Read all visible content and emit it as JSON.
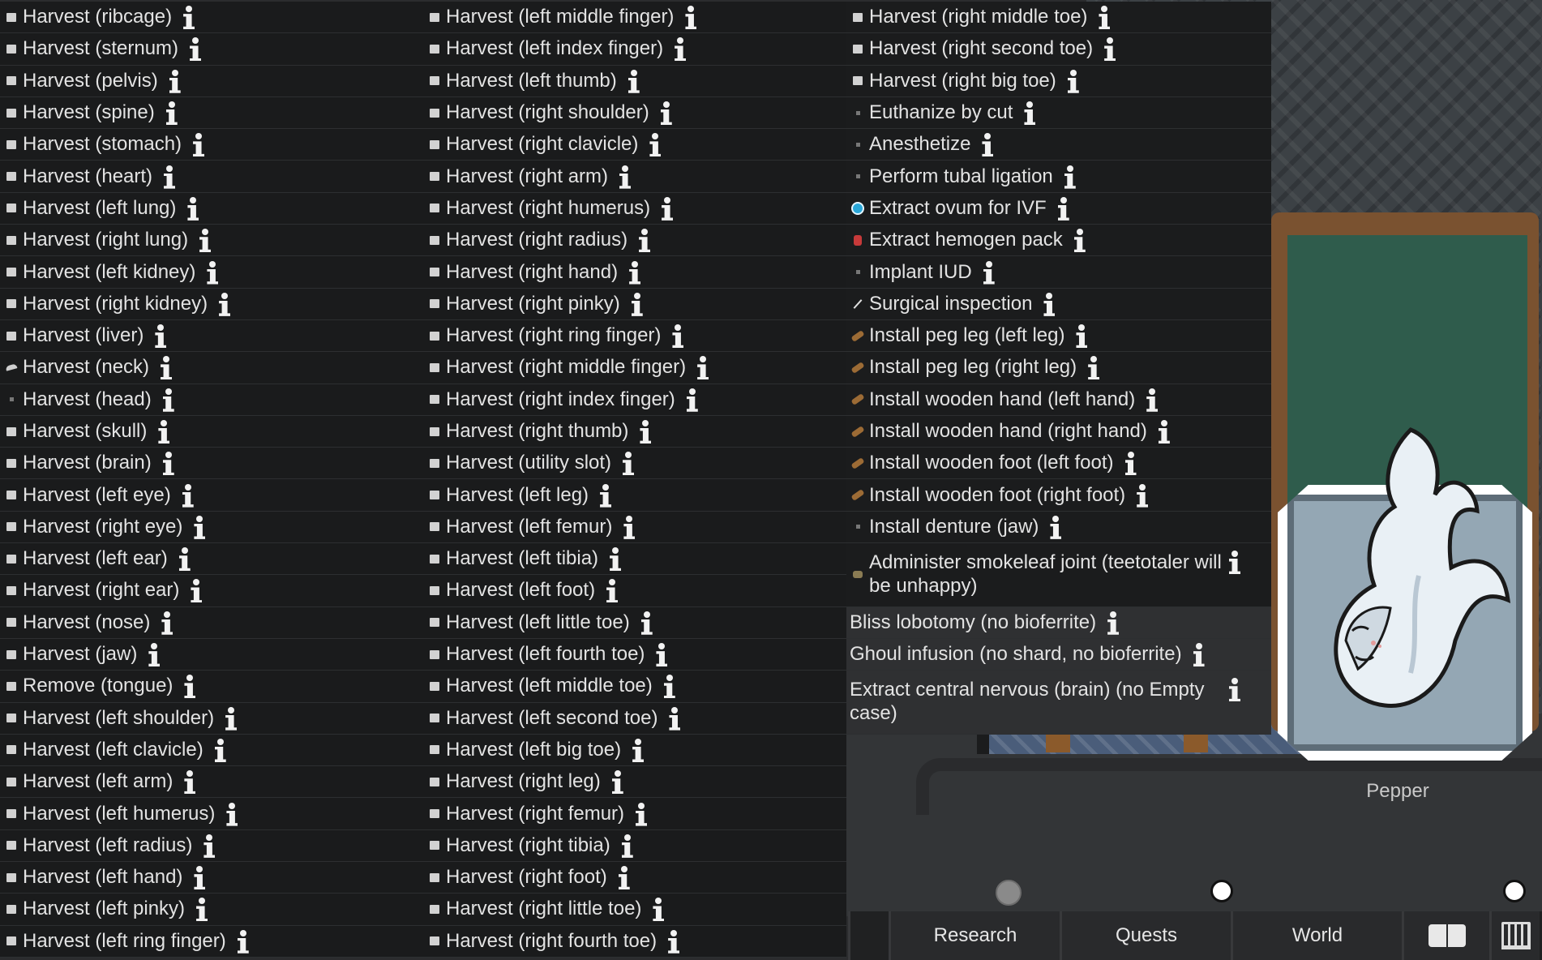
{
  "menu": {
    "col_a": [
      {
        "label": "Harvest (ribcage)",
        "icon": "square-icon"
      },
      {
        "label": "Harvest (sternum)",
        "icon": "square-icon"
      },
      {
        "label": "Harvest (pelvis)",
        "icon": "square-icon"
      },
      {
        "label": "Harvest (spine)",
        "icon": "square-icon"
      },
      {
        "label": "Harvest (stomach)",
        "icon": "square-icon"
      },
      {
        "label": "Harvest (heart)",
        "icon": "square-icon"
      },
      {
        "label": "Harvest (left lung)",
        "icon": "square-icon"
      },
      {
        "label": "Harvest (right lung)",
        "icon": "square-icon"
      },
      {
        "label": "Harvest (left kidney)",
        "icon": "square-icon"
      },
      {
        "label": "Harvest (right kidney)",
        "icon": "square-icon"
      },
      {
        "label": "Harvest (liver)",
        "icon": "square-icon"
      },
      {
        "label": "Harvest (neck)",
        "icon": "knife-icon"
      },
      {
        "label": "Harvest (head)",
        "icon": "dot-icon"
      },
      {
        "label": "Harvest (skull)",
        "icon": "square-icon"
      },
      {
        "label": "Harvest (brain)",
        "icon": "square-icon"
      },
      {
        "label": "Harvest (left eye)",
        "icon": "square-icon"
      },
      {
        "label": "Harvest (right eye)",
        "icon": "square-icon"
      },
      {
        "label": "Harvest (left ear)",
        "icon": "square-icon"
      },
      {
        "label": "Harvest (right ear)",
        "icon": "square-icon"
      },
      {
        "label": "Harvest (nose)",
        "icon": "square-icon"
      },
      {
        "label": "Harvest (jaw)",
        "icon": "square-icon"
      },
      {
        "label": "Remove (tongue)",
        "icon": "square-icon"
      },
      {
        "label": "Harvest (left shoulder)",
        "icon": "square-icon"
      },
      {
        "label": "Harvest (left clavicle)",
        "icon": "square-icon"
      },
      {
        "label": "Harvest (left arm)",
        "icon": "square-icon"
      },
      {
        "label": "Harvest (left humerus)",
        "icon": "square-icon"
      },
      {
        "label": "Harvest (left radius)",
        "icon": "square-icon"
      },
      {
        "label": "Harvest (left hand)",
        "icon": "square-icon"
      },
      {
        "label": "Harvest (left pinky)",
        "icon": "square-icon"
      },
      {
        "label": "Harvest (left ring finger)",
        "icon": "square-icon"
      }
    ],
    "col_b": [
      {
        "label": "Harvest (left middle finger)",
        "icon": "square-icon"
      },
      {
        "label": "Harvest (left index finger)",
        "icon": "square-icon"
      },
      {
        "label": "Harvest (left thumb)",
        "icon": "square-icon"
      },
      {
        "label": "Harvest (right shoulder)",
        "icon": "square-icon"
      },
      {
        "label": "Harvest (right clavicle)",
        "icon": "square-icon"
      },
      {
        "label": "Harvest (right arm)",
        "icon": "square-icon"
      },
      {
        "label": "Harvest (right humerus)",
        "icon": "square-icon"
      },
      {
        "label": "Harvest (right radius)",
        "icon": "square-icon"
      },
      {
        "label": "Harvest (right hand)",
        "icon": "square-icon"
      },
      {
        "label": "Harvest (right pinky)",
        "icon": "square-icon"
      },
      {
        "label": "Harvest (right ring finger)",
        "icon": "square-icon"
      },
      {
        "label": "Harvest (right middle finger)",
        "icon": "square-icon"
      },
      {
        "label": "Harvest (right index finger)",
        "icon": "square-icon"
      },
      {
        "label": "Harvest (right thumb)",
        "icon": "square-icon"
      },
      {
        "label": "Harvest (utility slot)",
        "icon": "square-icon"
      },
      {
        "label": "Harvest (left leg)",
        "icon": "square-icon"
      },
      {
        "label": "Harvest (left femur)",
        "icon": "square-icon"
      },
      {
        "label": "Harvest (left tibia)",
        "icon": "square-icon"
      },
      {
        "label": "Harvest (left foot)",
        "icon": "square-icon"
      },
      {
        "label": "Harvest (left little toe)",
        "icon": "square-icon"
      },
      {
        "label": "Harvest (left fourth toe)",
        "icon": "square-icon"
      },
      {
        "label": "Harvest (left middle toe)",
        "icon": "square-icon"
      },
      {
        "label": "Harvest (left second toe)",
        "icon": "square-icon"
      },
      {
        "label": "Harvest (left big toe)",
        "icon": "square-icon"
      },
      {
        "label": "Harvest (right leg)",
        "icon": "square-icon"
      },
      {
        "label": "Harvest (right femur)",
        "icon": "square-icon"
      },
      {
        "label": "Harvest (right tibia)",
        "icon": "square-icon"
      },
      {
        "label": "Harvest (right foot)",
        "icon": "square-icon"
      },
      {
        "label": "Harvest (right little toe)",
        "icon": "square-icon"
      },
      {
        "label": "Harvest (right fourth toe)",
        "icon": "square-icon"
      }
    ],
    "col_c": [
      {
        "label": "Harvest (right middle toe)",
        "icon": "square-icon"
      },
      {
        "label": "Harvest (right second toe)",
        "icon": "square-icon"
      },
      {
        "label": "Harvest (right big toe)",
        "icon": "square-icon"
      },
      {
        "label": "Euthanize by cut",
        "icon": "dot-icon"
      },
      {
        "label": "Anesthetize",
        "icon": "dot-icon"
      },
      {
        "label": "Perform tubal ligation",
        "icon": "dot-icon"
      },
      {
        "label": "Extract ovum for IVF",
        "icon": "ovum-icon"
      },
      {
        "label": "Extract hemogen pack",
        "icon": "hemogen-pack-icon"
      },
      {
        "label": "Implant IUD",
        "icon": "dot-icon"
      },
      {
        "label": "Surgical inspection",
        "icon": "scalpel-line-icon"
      },
      {
        "label": "Install peg leg (left leg)",
        "icon": "peg-leg-icon"
      },
      {
        "label": "Install peg leg (right leg)",
        "icon": "peg-leg-icon"
      },
      {
        "label": "Install wooden hand (left hand)",
        "icon": "wooden-hand-icon"
      },
      {
        "label": "Install wooden hand (right hand)",
        "icon": "wooden-hand-icon"
      },
      {
        "label": "Install wooden foot (left foot)",
        "icon": "wooden-foot-icon"
      },
      {
        "label": "Install wooden foot (right foot)",
        "icon": "wooden-foot-icon"
      },
      {
        "label": "Install denture (jaw)",
        "icon": "dot-icon"
      },
      {
        "label": "Administer smokeleaf joint (teetotaler will be unhappy)",
        "icon": "smokeleaf-joint-icon",
        "tall": true
      },
      {
        "label": "Bliss lobotomy (no bioferrite)",
        "icon": "none",
        "disabled": true
      },
      {
        "label": "Ghoul infusion (no shard, no bioferrite)",
        "icon": "none",
        "disabled": true
      },
      {
        "label": "Extract central nervous (brain) (no Empty case)",
        "icon": "none",
        "disabled": true,
        "tall": true
      }
    ]
  },
  "pawn": {
    "name": "Pepper"
  },
  "bottom_bar": {
    "tabs": [
      {
        "label": ""
      },
      {
        "label": "Research"
      },
      {
        "label": "Quests"
      },
      {
        "label": "World"
      },
      {
        "label": "",
        "icon": "book-icon"
      },
      {
        "label": "",
        "icon": "architect-icon"
      }
    ]
  },
  "colors": {
    "menu_bg": "#1a1b1c",
    "disabled_bg": "#2f3032",
    "text": "#e3e3e3",
    "portrait_border": "#ffffff"
  }
}
